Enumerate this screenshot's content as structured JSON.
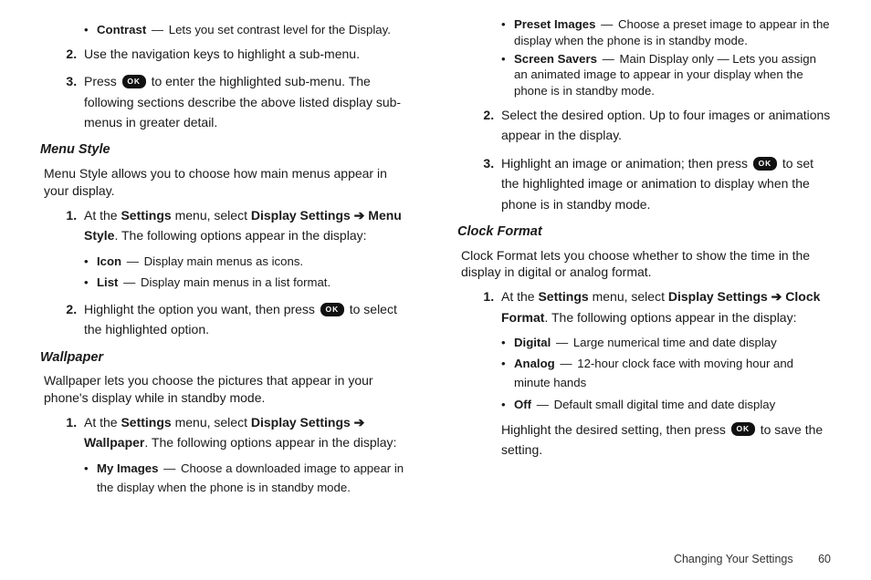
{
  "leftCol": {
    "topBullet": {
      "term": "Contrast",
      "desc": "Lets you set contrast level for the Display."
    },
    "topSteps": [
      "Use the navigation keys to highlight a sub-menu.",
      {
        "pre": "Press ",
        "post": " to enter the highlighted sub-menu. The following sections describe the above listed display sub-menus in greater detail."
      }
    ],
    "menuStyle": {
      "heading": "Menu Style",
      "intro": "Menu Style allows you to choose how main menus appear in your display.",
      "step1": {
        "pre": "At the ",
        "settings": "Settings",
        "mid": " menu, select ",
        "path1": "Display Settings",
        "arrow": " ➔ ",
        "path2": "Menu Style",
        "post": ". The following options appear in the display:"
      },
      "opts": [
        {
          "term": "Icon",
          "desc": "Display main menus as icons."
        },
        {
          "term": "List",
          "desc": "Display main menus in a list format."
        }
      ],
      "step2": {
        "pre": "Highlight the option you want, then press ",
        "post": " to select the highlighted option."
      }
    },
    "wallpaper": {
      "heading": "Wallpaper",
      "intro": "Wallpaper lets you choose the pictures that appear in your phone's display while in standby mode.",
      "step1": {
        "pre": "At the ",
        "settings": "Settings",
        "mid": " menu, select ",
        "path1": "Display Settings",
        "arrow": " ➔ ",
        "path2": "Wallpaper",
        "post": ". The following options appear in the display:"
      },
      "opt1": {
        "term": "My Images",
        "desc": "Choose a downloaded image to appear in the display when the phone is in standby mode."
      }
    }
  },
  "rightCol": {
    "wallpaperCont": {
      "opts": [
        {
          "term": "Preset Images",
          "desc": "Choose a preset image to appear in the display when the phone is in standby mode."
        },
        {
          "term": "Screen Savers",
          "desc": "Main Display only — Lets you assign an animated image to appear in your display when the phone is in standby mode."
        }
      ],
      "step2": "Select the desired option. Up to four images or animations appear in the display.",
      "step3": {
        "pre": "Highlight an image or animation; then press ",
        "post": " to set the highlighted image or animation to display when the phone is in standby mode."
      }
    },
    "clockFormat": {
      "heading": "Clock Format",
      "intro": "Clock Format lets you choose whether to show the time in the display in digital or analog format.",
      "step1": {
        "pre": "At the ",
        "settings": "Settings",
        "mid": " menu, select ",
        "path1": "Display Settings",
        "arrow": " ➔ ",
        "path2": "Clock Format",
        "post": ". The following options appear in the display:"
      },
      "opts": [
        {
          "term": "Digital",
          "desc": "Large numerical time and date display"
        },
        {
          "term": "Analog",
          "desc": "12-hour clock face with moving hour and minute hands"
        },
        {
          "term": "Off",
          "desc": "Default small digital time and date display"
        }
      ],
      "tail": {
        "pre": "Highlight the desired setting, then press ",
        "post": " to save the setting."
      }
    }
  },
  "footer": {
    "section": "Changing Your Settings",
    "page": "60"
  },
  "okLabel": "OK"
}
